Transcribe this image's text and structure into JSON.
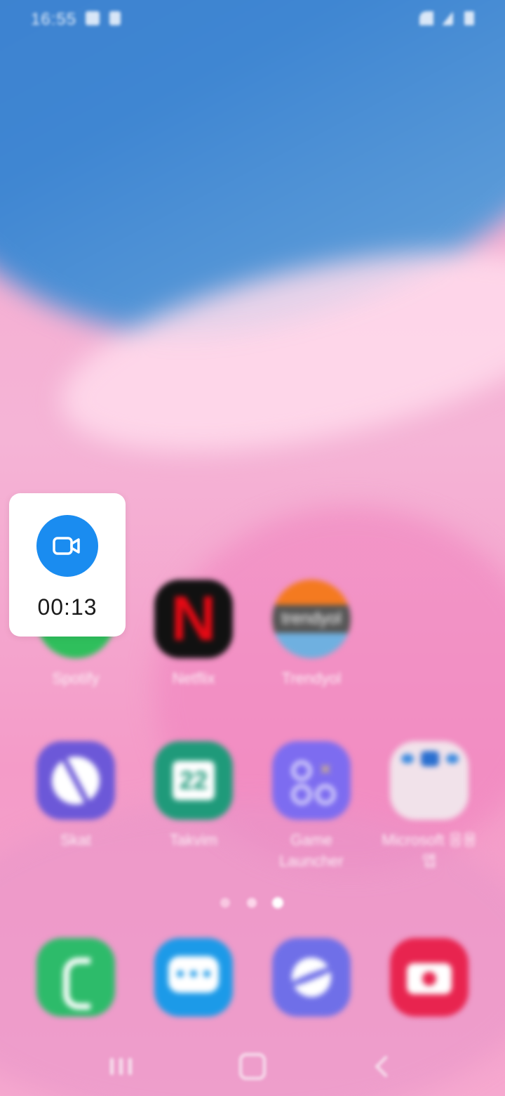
{
  "status_bar": {
    "time": "16:55"
  },
  "apps": [
    {
      "label": "Spotify",
      "icon": "spotify-icon",
      "color": "#2fbf5c"
    },
    {
      "label": "Netflix",
      "icon": "netflix-icon",
      "color": "#111111",
      "glyph": "N"
    },
    {
      "label": "Trendyol",
      "icon": "trendyol-icon",
      "color": "#f47a20",
      "glyph": "trendyol"
    },
    {
      "label": "Skat",
      "icon": "compass-icon",
      "color": "#6c58d8"
    },
    {
      "label": "Takvim",
      "icon": "calendar-icon",
      "color": "#1f9a7a",
      "glyph": "22"
    },
    {
      "label": "Game Launcher",
      "icon": "game-launcher-icon",
      "color": "#7d6cf0"
    },
    {
      "label": "Microsoft 응용 앱",
      "icon": "microsoft-folder-icon",
      "color": "#f1e2ea"
    }
  ],
  "page_indicator": {
    "count": 3,
    "active_index": 2
  },
  "dock": [
    {
      "name": "phone",
      "icon": "phone-icon",
      "color": "#2dbb6a"
    },
    {
      "name": "messages",
      "icon": "messages-icon",
      "color": "#1c9ae8"
    },
    {
      "name": "internet",
      "icon": "internet-icon",
      "color": "#6f6fe8"
    },
    {
      "name": "camera",
      "icon": "camera-icon",
      "color": "#e8244f"
    }
  ],
  "recorder": {
    "icon": "video-camera-icon",
    "button_color": "#1a8cf0",
    "elapsed": "00:13"
  },
  "navbar": {
    "recent": "recent-apps-icon",
    "home": "home-icon",
    "back": "back-icon"
  }
}
